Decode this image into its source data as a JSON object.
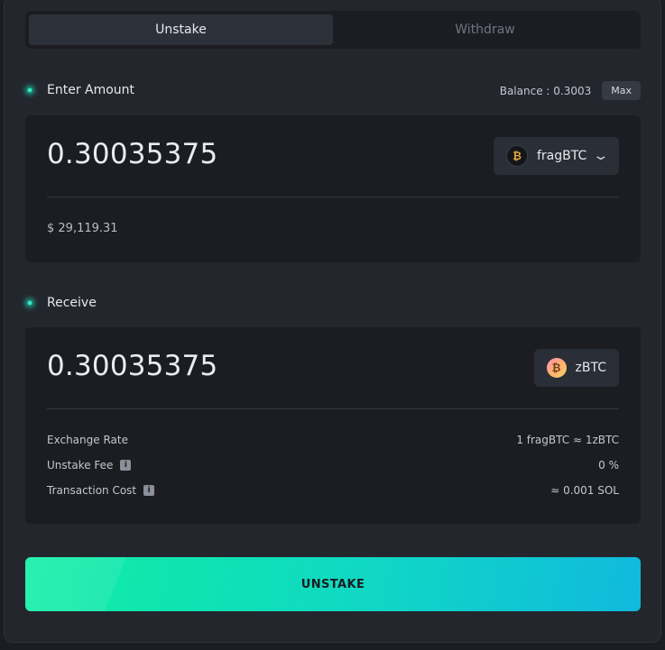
{
  "tabs": [
    {
      "label": "Unstake",
      "active": true
    },
    {
      "label": "Withdraw",
      "active": false
    }
  ],
  "enter_amount": {
    "title": "Enter Amount",
    "balance": "Balance : 0.3003",
    "max_label": "Max",
    "amount": "0.30035375",
    "token": "fragBTC",
    "usd_value": "$ 29,119.31"
  },
  "receive": {
    "title": "Receive",
    "amount": "0.30035375",
    "token": "zBTC",
    "details": [
      {
        "label": "Exchange Rate",
        "value": "1 fragBTC ≈ 1zBTC",
        "info": false
      },
      {
        "label": "Unstake Fee",
        "value": "0 %",
        "info": true
      },
      {
        "label": "Transaction Cost",
        "value": "≈ 0.001 SOL",
        "info": true
      }
    ]
  },
  "cta_label": "UNSTAKE",
  "colors": {
    "accent_start": "#17f0a8",
    "accent_end": "#10b9dd",
    "dot": "#34e7c4"
  },
  "icons": {
    "frag_token": "fragbtc-token-icon",
    "zbtc_token": "zbtc-token-icon",
    "dropdown": "chevron-down-icon",
    "info": "info-icon"
  }
}
